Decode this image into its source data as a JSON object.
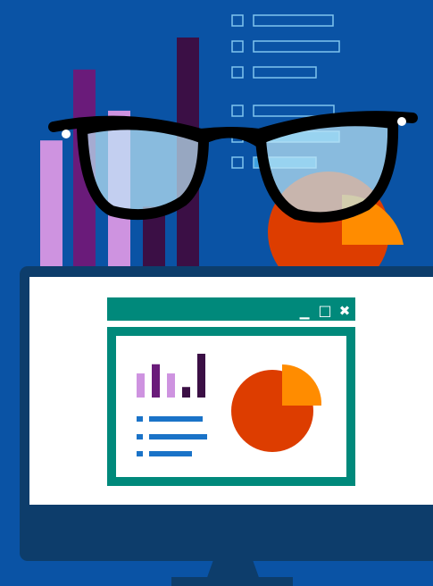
{
  "illustration": {
    "kind": "data-analysis-illustration",
    "colors": {
      "background": "#0a53a5",
      "monitor_frame": "#0d3d6b",
      "screen": "#ffffff",
      "window_accent": "#00897b",
      "bar_light_purple": "#ce93e0",
      "bar_purple": "#6a1b7a",
      "bar_dark_purple": "#3b0f45",
      "pie_main": "#dd3d00",
      "pie_slice": "#ff8c00",
      "list_line": "#1a73c8",
      "lens": "#bfe8f7",
      "glasses_frame": "#000000"
    },
    "icons": {
      "minimize": "minimize-icon",
      "maximize": "maximize-icon",
      "close": "close-icon"
    },
    "window_controls_text": {
      "minimize": "▁",
      "maximize": "□",
      "close": "✖"
    },
    "background_bar_levels": [
      0.55,
      0.86,
      0.68,
      0.26,
      1.0
    ],
    "mini_bar_levels": [
      0.55,
      0.76,
      0.55,
      0.24,
      1.0
    ],
    "pie_slice_fraction": 0.25
  }
}
